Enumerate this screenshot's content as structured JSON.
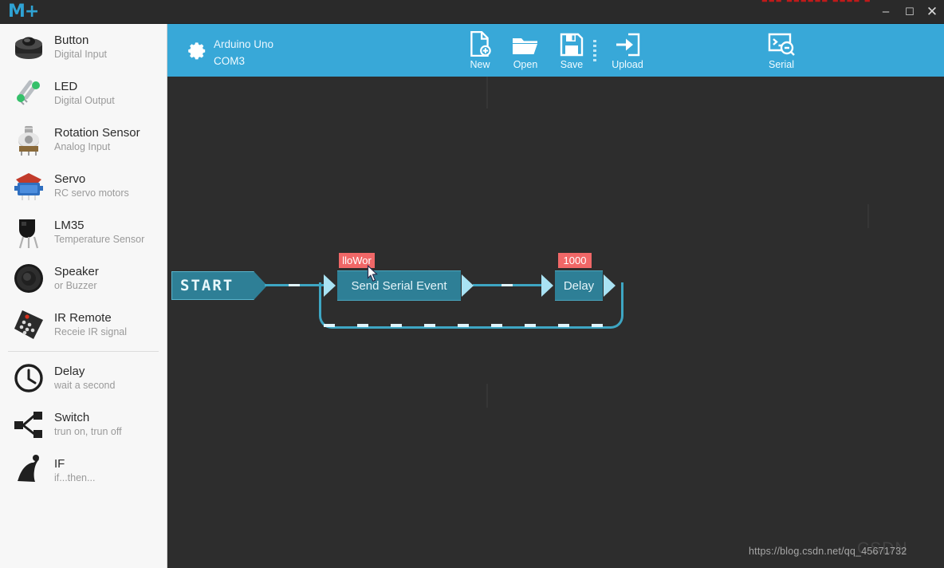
{
  "titlebar": {
    "logo": "M+",
    "red_text": "■■■ ■■■■■■ ■■■■ ■",
    "minimize": "–",
    "maximize": "☐",
    "close": "✕"
  },
  "sidebar": {
    "groups": [
      {
        "items": [
          {
            "icon": "push-button-icon",
            "title": "Button",
            "subtitle": "Digital Input"
          },
          {
            "icon": "led-icon",
            "title": "LED",
            "subtitle": "Digital Output"
          },
          {
            "icon": "potentiometer-icon",
            "title": "Rotation Sensor",
            "subtitle": "Analog Input"
          },
          {
            "icon": "servo-motor-icon",
            "title": "Servo",
            "subtitle": "RC servo motors"
          },
          {
            "icon": "transistor-icon",
            "title": "LM35",
            "subtitle": "Temperature Sensor"
          },
          {
            "icon": "speaker-icon",
            "title": "Speaker",
            "subtitle": "or Buzzer"
          },
          {
            "icon": "remote-control-icon",
            "title": "IR Remote",
            "subtitle": "Receie IR signal"
          }
        ]
      },
      {
        "items": [
          {
            "icon": "clock-icon",
            "title": "Delay",
            "subtitle": "wait a second"
          },
          {
            "icon": "share-icon",
            "title": "Switch",
            "subtitle": "trun on, trun off"
          },
          {
            "icon": "bell-icon",
            "title": "IF",
            "subtitle": "if...then..."
          }
        ]
      }
    ]
  },
  "toolbar": {
    "settings_icon": "gear-icon",
    "board_name": "Arduino Uno",
    "board_port": "COM3",
    "buttons": [
      {
        "id": "new",
        "icon": "new-file-icon",
        "label": "New"
      },
      {
        "id": "open",
        "icon": "open-folder-icon",
        "label": "Open"
      },
      {
        "id": "save",
        "icon": "floppy-disk-icon",
        "label": "Save"
      },
      {
        "id": "upload",
        "icon": "upload-icon",
        "label": "Upload"
      },
      {
        "id": "serial",
        "icon": "serial-monitor-icon",
        "label": "Serial"
      }
    ],
    "trash_icon": "trash-icon",
    "accent_color": "#38a8d8"
  },
  "canvas": {
    "background_color": "#2d2d2d",
    "flow": {
      "start_label": "START",
      "nodes": [
        {
          "id": "send-serial-event",
          "label": "Send Serial Event",
          "badge": "lloWor"
        },
        {
          "id": "delay",
          "label": "Delay",
          "badge": "1000"
        }
      ],
      "node_color": "#2e7f96",
      "wire_color": "#3ea6c3",
      "badge_color": "#f06767"
    },
    "cursor": "mouse-pointer",
    "watermark": "https://blog.csdn.net/qq_45671732",
    "watermark_ghost": "CSDN"
  }
}
